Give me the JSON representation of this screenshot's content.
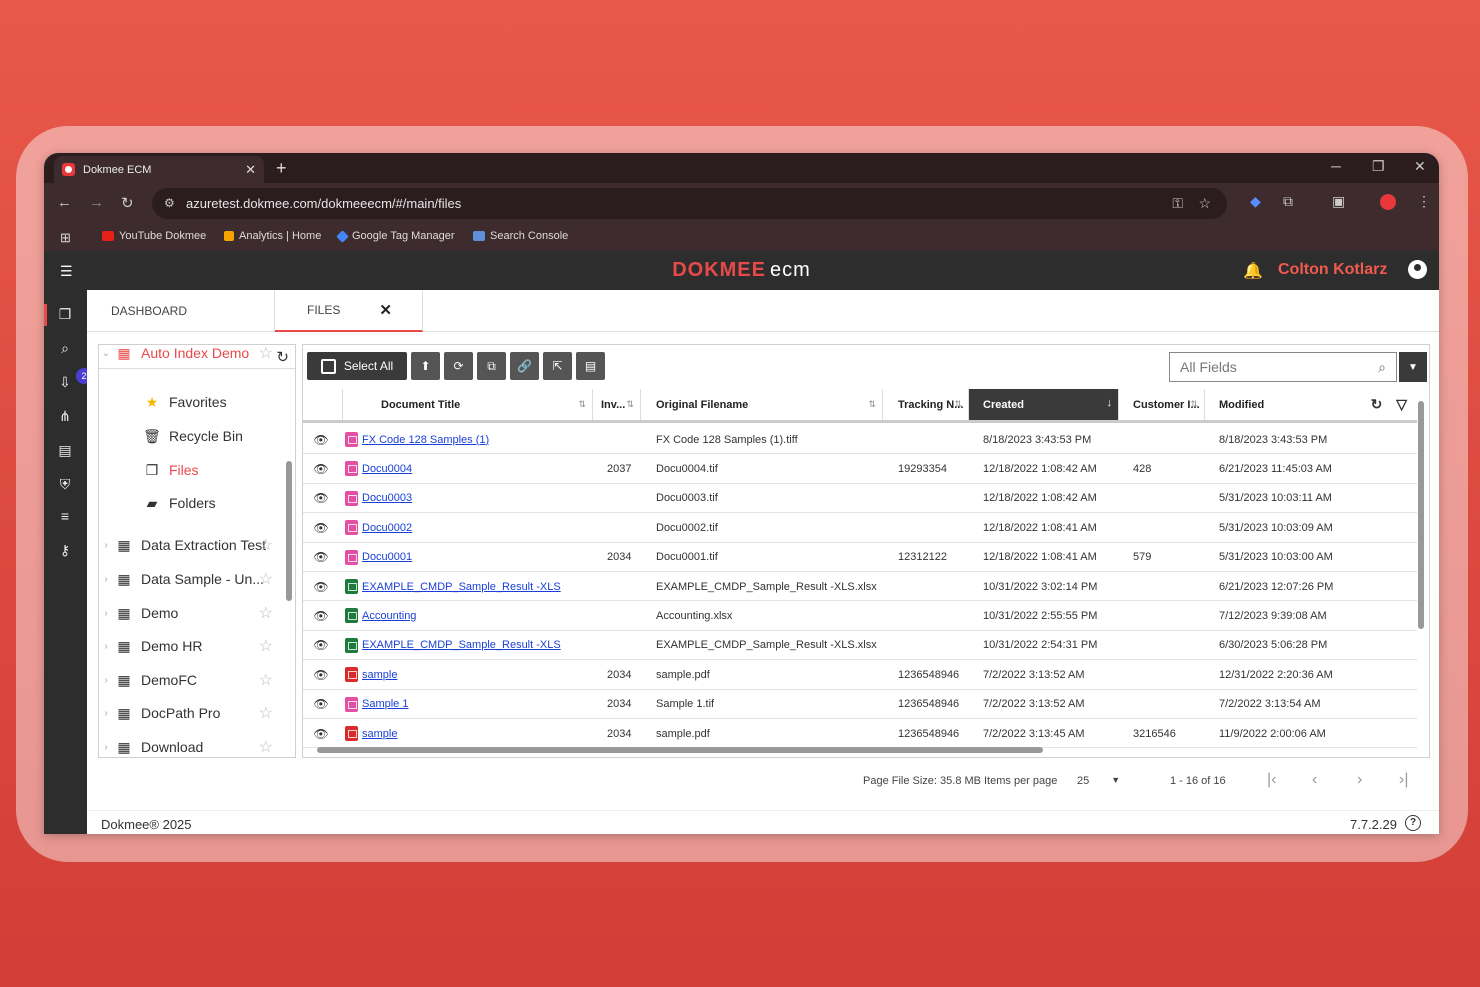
{
  "browser": {
    "tab_title": "Dokmee ECM",
    "url": "azuretest.dokmee.com/dokmeeecm/#/main/files",
    "bookmarks": [
      "YouTube Dokmee",
      "Analytics | Home",
      "Google Tag Manager",
      "Search Console"
    ]
  },
  "app": {
    "logo_main": "DOKMEE",
    "logo_sub": "ecm",
    "user_name": "Colton Kotlarz",
    "notification_count": "2"
  },
  "tabs": {
    "dashboard": "DASHBOARD",
    "files": "FILES"
  },
  "tree": {
    "items": [
      {
        "label": "Auto Index Demo",
        "icon": "database-icon",
        "starred": false
      },
      {
        "label": "Favorites",
        "icon": "star-icon"
      },
      {
        "label": "Recycle Bin",
        "icon": "trash-icon"
      },
      {
        "label": "Files",
        "icon": "file-icon",
        "active": true
      },
      {
        "label": "Folders",
        "icon": "folder-icon"
      },
      {
        "label": "Data Extraction Test",
        "icon": "database-icon"
      },
      {
        "label": "Data Sample - Un...",
        "icon": "database-icon"
      },
      {
        "label": "Demo",
        "icon": "database-icon"
      },
      {
        "label": "Demo HR",
        "icon": "database-icon"
      },
      {
        "label": "DemoFC",
        "icon": "database-icon"
      },
      {
        "label": "DocPath Pro",
        "icon": "database-icon"
      },
      {
        "label": "Download",
        "icon": "database-icon"
      }
    ]
  },
  "grid": {
    "select_all_label": "Select All",
    "search_placeholder": "All Fields",
    "columns": [
      "Document Title",
      "Inv...",
      "Original Filename",
      "Tracking N...",
      "Created",
      "Customer I...",
      "Modified"
    ],
    "rows": [
      {
        "type": "tif",
        "title": "FX Code 128 Samples (1)",
        "inv": "",
        "filename": "FX Code 128 Samples (1).tiff",
        "tracking": "",
        "created": "8/18/2023 3:43:53 PM",
        "customer": "",
        "modified": "8/18/2023 3:43:53 PM"
      },
      {
        "type": "tif",
        "title": "Docu0004",
        "inv": "2037",
        "filename": "Docu0004.tif",
        "tracking": "19293354",
        "created": "12/18/2022 1:08:42 AM",
        "customer": "428",
        "modified": "6/21/2023 11:45:03 AM"
      },
      {
        "type": "tif",
        "title": "Docu0003",
        "inv": "",
        "filename": "Docu0003.tif",
        "tracking": "",
        "created": "12/18/2022 1:08:42 AM",
        "customer": "",
        "modified": "5/31/2023 10:03:11 AM"
      },
      {
        "type": "tif",
        "title": "Docu0002",
        "inv": "",
        "filename": "Docu0002.tif",
        "tracking": "",
        "created": "12/18/2022 1:08:41 AM",
        "customer": "",
        "modified": "5/31/2023 10:03:09 AM"
      },
      {
        "type": "tif",
        "title": "Docu0001",
        "inv": "2034",
        "filename": "Docu0001.tif",
        "tracking": "12312122",
        "created": "12/18/2022 1:08:41 AM",
        "customer": "579",
        "modified": "5/31/2023 10:03:00 AM"
      },
      {
        "type": "xls",
        "title": "EXAMPLE_CMDP_Sample_Result -XLS",
        "inv": "",
        "filename": "EXAMPLE_CMDP_Sample_Result -XLS.xlsx",
        "tracking": "",
        "created": "10/31/2022 3:02:14 PM",
        "customer": "",
        "modified": "6/21/2023 12:07:26 PM"
      },
      {
        "type": "xls",
        "title": "Accounting",
        "inv": "",
        "filename": "Accounting.xlsx",
        "tracking": "",
        "created": "10/31/2022 2:55:55 PM",
        "customer": "",
        "modified": "7/12/2023 9:39:08 AM"
      },
      {
        "type": "xls",
        "title": "EXAMPLE_CMDP_Sample_Result -XLS",
        "inv": "",
        "filename": "EXAMPLE_CMDP_Sample_Result -XLS.xlsx",
        "tracking": "",
        "created": "10/31/2022 2:54:31 PM",
        "customer": "",
        "modified": "6/30/2023 5:06:28 PM"
      },
      {
        "type": "pdf",
        "title": "sample",
        "inv": "2034",
        "filename": "sample.pdf",
        "tracking": "1236548946",
        "created": "7/2/2022 3:13:52 AM",
        "customer": "",
        "modified": "12/31/2022 2:20:36 AM"
      },
      {
        "type": "tif",
        "title": "Sample 1",
        "inv": "2034",
        "filename": "Sample 1.tif",
        "tracking": "1236548946",
        "created": "7/2/2022 3:13:52 AM",
        "customer": "",
        "modified": "7/2/2022 3:13:54 AM"
      },
      {
        "type": "pdf",
        "title": "sample",
        "inv": "2034",
        "filename": "sample.pdf",
        "tracking": "1236548946",
        "created": "7/2/2022 3:13:45 AM",
        "customer": "3216546",
        "modified": "11/9/2022 2:00:06 AM"
      }
    ]
  },
  "pager": {
    "page_file_size": "Page File Size: 35.8 MB",
    "items_per_page_label": "Items per page",
    "items_per_page": "25",
    "range": "1 - 16 of 16"
  },
  "footer": {
    "copyright": "Dokmee® 2025",
    "version": "7.7.2.29"
  },
  "colors": {
    "accent": "#e84a4a",
    "dark": "#2d2d2d",
    "link": "#1a3fd8"
  }
}
